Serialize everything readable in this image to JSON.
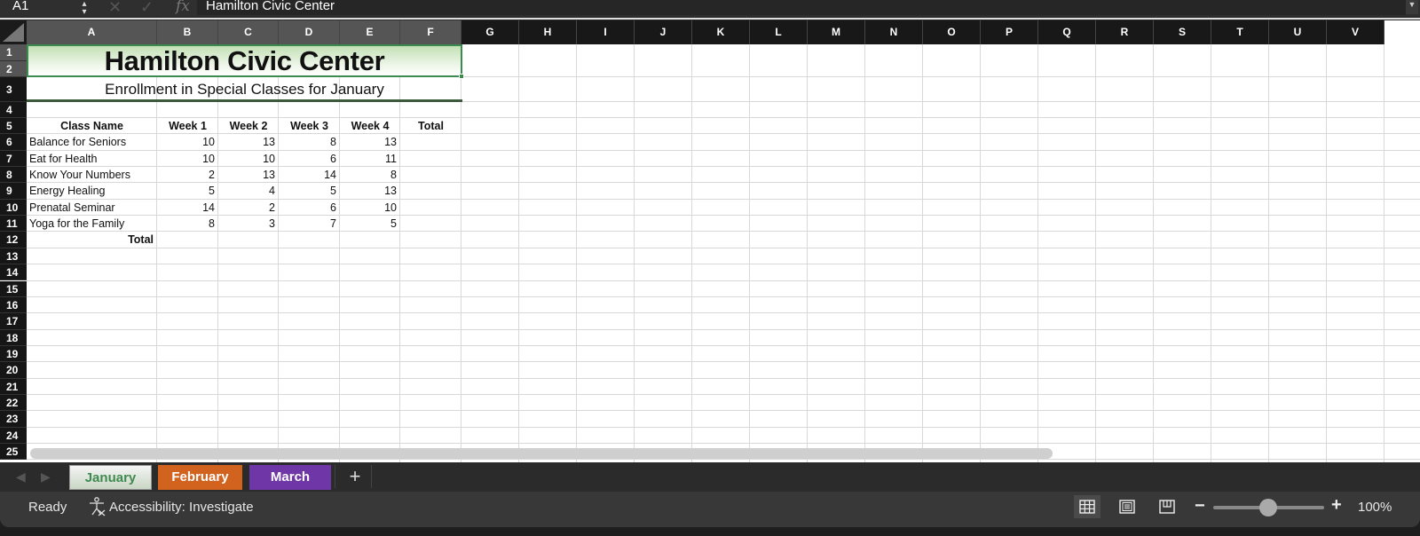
{
  "formula_bar": {
    "name_box": "A1",
    "cancel_icon": "✕",
    "enter_icon": "✓",
    "fx_label": "fx",
    "formula": "Hamilton Civic Center"
  },
  "columns": [
    "A",
    "B",
    "C",
    "D",
    "E",
    "F",
    "G",
    "H",
    "I",
    "J",
    "K",
    "L",
    "M",
    "N",
    "O",
    "P",
    "Q",
    "R",
    "S",
    "T",
    "U",
    "V"
  ],
  "rows": [
    "1",
    "2",
    "3",
    "4",
    "5",
    "6",
    "7",
    "8",
    "9",
    "10",
    "11",
    "12",
    "13",
    "14",
    "15",
    "16",
    "17",
    "18",
    "19",
    "20",
    "21",
    "22",
    "23",
    "24",
    "25"
  ],
  "sheet": {
    "title": "Hamilton Civic Center",
    "subtitle": "Enrollment in Special Classes for January",
    "headers": [
      "Class Name",
      "Week 1",
      "Week 2",
      "Week 3",
      "Week 4",
      "Total"
    ],
    "data_rows": [
      {
        "name": "Balance for Seniors",
        "values": [
          "10",
          "13",
          "8",
          "13"
        ]
      },
      {
        "name": "Eat for Health",
        "values": [
          "10",
          "10",
          "6",
          "11"
        ]
      },
      {
        "name": "Know Your Numbers",
        "values": [
          "2",
          "13",
          "14",
          "8"
        ]
      },
      {
        "name": "Energy Healing",
        "values": [
          "5",
          "4",
          "5",
          "13"
        ]
      },
      {
        "name": "Prenatal Seminar",
        "values": [
          "14",
          "2",
          "6",
          "10"
        ]
      },
      {
        "name": "Yoga for the Family",
        "values": [
          "8",
          "3",
          "7",
          "5"
        ]
      }
    ],
    "total_label": "Total"
  },
  "tabs": [
    {
      "label": "January",
      "color": "#3f8a4f",
      "active": true
    },
    {
      "label": "February",
      "color": "#d2631f",
      "active": false
    },
    {
      "label": "March",
      "color": "#6f36a8",
      "active": false
    }
  ],
  "add_sheet_label": "+",
  "status": {
    "ready": "Ready",
    "accessibility": "Accessibility: Investigate",
    "zoom_minus": "−",
    "zoom_plus": "+",
    "zoom_level": "100%",
    "zoom_percent": 100
  }
}
